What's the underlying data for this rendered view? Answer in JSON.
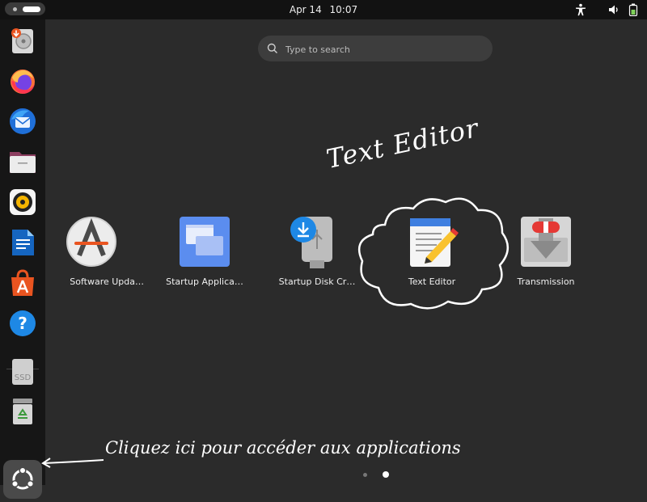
{
  "topbar": {
    "date": "Apr 14",
    "time": "10:07",
    "tray_icons": [
      "accessibility-icon",
      "volume-icon",
      "battery-icon"
    ]
  },
  "dock": {
    "items": [
      {
        "name": "software-updater-icon"
      },
      {
        "name": "firefox-icon"
      },
      {
        "name": "thunderbird-icon"
      },
      {
        "name": "files-icon"
      },
      {
        "name": "rhythmbox-icon"
      },
      {
        "name": "libreoffice-writer-icon"
      },
      {
        "name": "app-center-icon"
      },
      {
        "name": "help-icon"
      },
      {
        "name": "ssd-drive-icon",
        "label": "SSD"
      },
      {
        "name": "trash-icon"
      }
    ],
    "show_apps_icon": "ubuntu-logo-icon"
  },
  "search": {
    "placeholder": "Type to search"
  },
  "apps": [
    {
      "label": "Software Upda…",
      "icon": "software-updater-icon"
    },
    {
      "label": "Startup Applica…",
      "icon": "startup-applications-icon"
    },
    {
      "label": "Startup Disk Cr…",
      "icon": "usb-drive-icon"
    },
    {
      "label": "Text Editor",
      "icon": "text-editor-icon"
    },
    {
      "label": "Transmission",
      "icon": "transmission-icon"
    }
  ],
  "annotations": {
    "title": "Text Editor",
    "hint": "Cliquez ici pour accéder aux applications"
  },
  "pagination": {
    "pages": 2,
    "current": 2
  },
  "colors": {
    "background": "#2b2b2b",
    "topbar": "#121212",
    "dock": "#161616",
    "ubuntu_orange": "#e95420"
  }
}
